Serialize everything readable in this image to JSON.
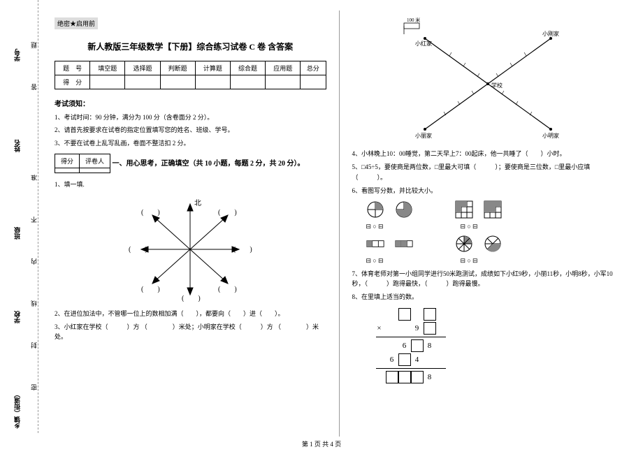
{
  "binding": {
    "labels": [
      "乡镇（街道）",
      "学校",
      "班级",
      "姓名",
      "学号"
    ],
    "hints": [
      "密",
      "封",
      "线",
      "内",
      "不",
      "准",
      "答",
      "题"
    ]
  },
  "confidential": "绝密★启用前",
  "title": "新人教版三年级数学【下册】综合练习试卷 C 卷 含答案",
  "score_table": {
    "row1": [
      "题　号",
      "填空题",
      "选择题",
      "判断题",
      "计算题",
      "综合题",
      "应用题",
      "总分"
    ],
    "row2_label": "得　分"
  },
  "exam_notes_title": "考试须知：",
  "exam_notes": [
    "1、考试时间：90 分钟，满分为 100 分（含卷面分 2 分）。",
    "2、请首先按要求在试卷的指定位置填写您的姓名、班级、学号。",
    "3、不要在试卷上乱写乱画，卷面不整洁扣 2 分。"
  ],
  "small_table": {
    "c1": "得分",
    "c2": "评卷人"
  },
  "section1_title": "一、用心思考，正确填空（共 10 小题，每题 2 分，共 20 分）。",
  "q1": "1、填一填.",
  "compass_labels": {
    "top": "北",
    "paren": [
      "(　　) ",
      " (　　)"
    ]
  },
  "q2": "2、在进位加法中，不管哪一位上的数相加满（　　），都要向（　　）进（　　）。",
  "q3": "3、小红家在学校（　　　）方 （　　　　）米处；小明家在学校（　　　）方 （　　　　）米处。",
  "roadmap": {
    "scale": "100 米",
    "points": [
      "小刚家",
      "小红家",
      "学校",
      "小丽家",
      "小明家"
    ]
  },
  "q4": "4、小林晚上10：00睡觉，第二天早上7：00起床，他一共睡了（　　）小时。",
  "q5": "5、□45÷5，要使商是两位数，□里最大可填（　　　）；要使商是三位数，□里最小应填（　　　）。",
  "q6": "6、看图写分数，并比较大小。",
  "frac_symbols": "○",
  "frac_box": "⊟",
  "q7": "7、体育老师对第一小组同学进行50米跑测试，成绩如下小红9秒，小丽11秒，小明8秒，小军10秒，（　　　）跑得最快，（　　　）跑得最慢。",
  "q8": "8、在里填上适当的数。",
  "mult": {
    "r1": [
      "",
      ""
    ],
    "r2": [
      "×",
      "",
      "9",
      ""
    ],
    "r3": [
      "6",
      "",
      "8"
    ],
    "r4": [
      "6",
      "",
      "4"
    ],
    "r5": [
      "",
      "",
      "",
      "8"
    ]
  },
  "footer": "第 1 页 共 4 页"
}
